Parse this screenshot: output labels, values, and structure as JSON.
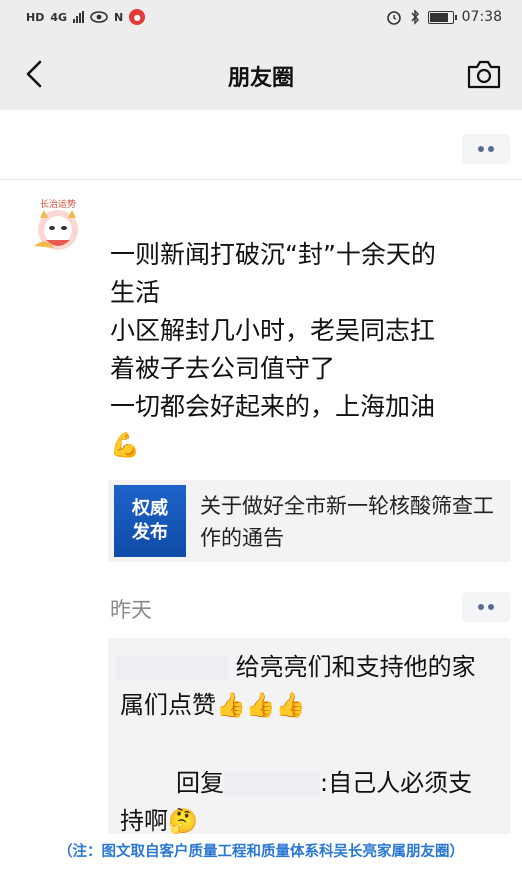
{
  "status_bar": {
    "network": "4G",
    "network_rate": "HD",
    "nfc_label": "N",
    "time": "07:38",
    "battery_level": 0.85
  },
  "nav": {
    "title": "朋友圈"
  },
  "post": {
    "avatar_text": "长治运势",
    "lines": [
      "一则新闻打破沉“封”十余天的",
      "生活",
      "小区解封几小时，老吴同志扛",
      "着被子去公司值守了",
      "一切都会好起来的，上海加油"
    ],
    "emoji": "💪",
    "link": {
      "thumb_line1": "权威",
      "thumb_line2": "发布",
      "title": "关于做好全市新一轮核酸筛查工作的通告"
    },
    "timestamp": "昨天"
  },
  "comments": [
    {
      "text_line1": "给亮亮们和支持他的家",
      "text_line2": "属们点赞",
      "emoji": "👍👍👍"
    },
    {
      "reply_label": "回复",
      "text_line1": ":自己人必须支",
      "text_line2": "持啊",
      "emoji": "🤔"
    }
  ],
  "footnote": "（注：图文取自客户质量工程和质量体系科吴长亮家属朋友圈）",
  "colors": {
    "link_blue": "#576b95",
    "footnote_blue": "#2a78d2",
    "bar_gray": "#ededed"
  }
}
